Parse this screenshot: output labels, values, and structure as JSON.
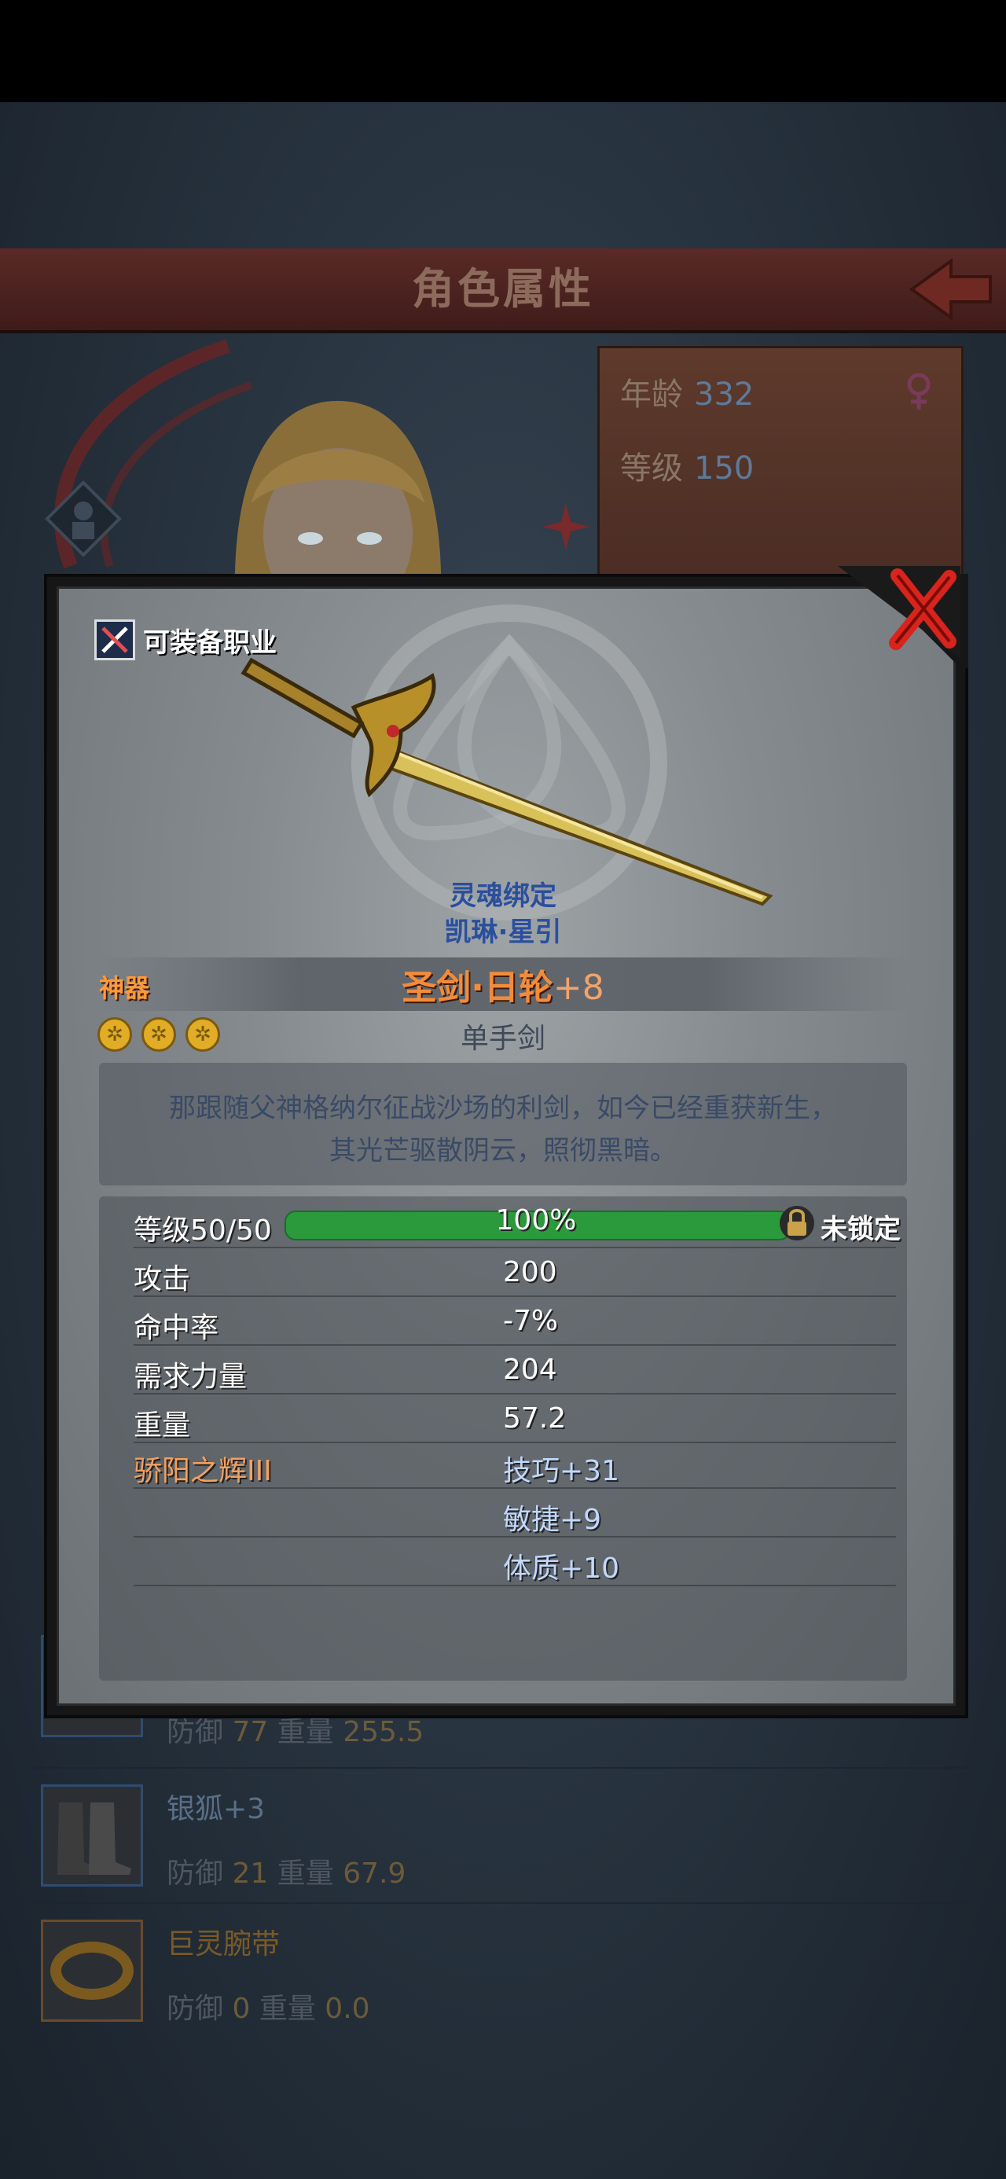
{
  "header": {
    "title": "角色属性"
  },
  "character": {
    "age_label": "年龄",
    "age_value": "332",
    "level_label": "等级",
    "level_value": "150"
  },
  "equipment_list": [
    {
      "name": "",
      "defense_label": "防御",
      "defense": "77",
      "weight_label": "重量",
      "weight": "255.5"
    },
    {
      "name": "银狐+3",
      "defense_label": "防御",
      "defense": "21",
      "weight_label": "重量",
      "weight": "67.9"
    },
    {
      "name": "巨灵腕带",
      "defense_label": "防御",
      "defense": "0",
      "weight_label": "重量",
      "weight": "0.0"
    }
  ],
  "item": {
    "class_label": "可装备职业",
    "bind_label": "灵魂绑定",
    "bind_owner": "凯琳·星引",
    "rarity": "神器",
    "name": "圣剑·日轮",
    "plus": "+8",
    "weapon_type": "单手剑",
    "stars": 3,
    "description_line1": "那跟随父神格纳尔征战沙场的利剑，如今已经重获新生，",
    "description_line2": "其光芒驱散阴云，照彻黑暗。",
    "level_label": "等级",
    "level_value": "50/50",
    "level_progress": 1.0,
    "level_percent": "100%",
    "lock_status": "未锁定",
    "stats": [
      {
        "label": "攻击",
        "value": "200"
      },
      {
        "label": "命中率",
        "value": "-7%"
      },
      {
        "label": "需求力量",
        "value": "204"
      },
      {
        "label": "重量",
        "value": "57.2"
      }
    ],
    "enchant": {
      "name": "骄阳之辉III",
      "bonuses": [
        "技巧+31",
        "敏捷+9",
        "体质+10"
      ]
    }
  },
  "colors": {
    "rarity_orange": "#f28c3c",
    "bind_blue": "#2a4f9e",
    "progress_green": "#2b9a3c",
    "close_red": "#d8241c"
  }
}
